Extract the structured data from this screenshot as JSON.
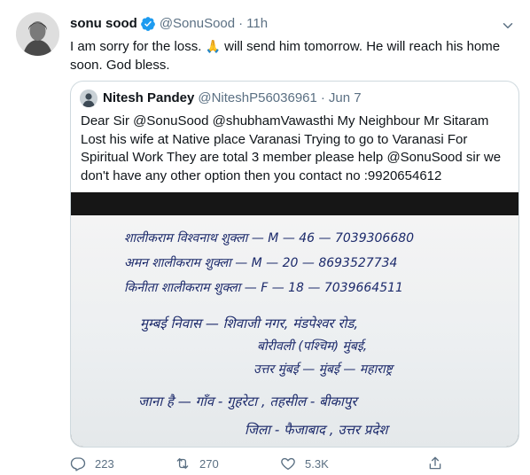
{
  "tweet": {
    "author_name": "sonu sood",
    "author_handle": "@SonuSood",
    "time": "11h",
    "text_before_emoji": "I am sorry for the loss. ",
    "emoji": "🙏",
    "text_after_emoji": " will send him tomorrow. He will reach his home soon. God bless."
  },
  "quote": {
    "author_name": "Nitesh Pandey",
    "author_handle": "@NiteshP56036961",
    "date": "Jun 7",
    "text": "Dear Sir @SonuSood @shubhamVawasthi My Neighbour Mr Sitaram Lost his wife at Native place Varanasi Trying to go to Varanasi For Spiritual Work They are total 3 member please help @SonuSood  sir we don't have any other option then you contact no :9920654612",
    "note_lines": [
      "शालीकराम विश्वनाथ शुक्ला — M — 46 — 7039306680",
      "अमन   शालीकराम शुक्ला — M — 20 — 8693527734",
      "किनीता  शालीकराम शुक्ला — F — 18 — 7039664511",
      "मुम्बई निवास — शिवाजी नगर, मंडपेश्वर रोड,",
      "बोरीवली (पश्चिम) मुंबई,",
      "उत्तर मुंबई — मुंबई — महाराष्ट्र",
      "जाना है — गाँव - गुहरेटा ,  तहसील - बीकापुर",
      "जिला - फैजाबाद , उत्तर प्रदेश"
    ]
  },
  "actions": {
    "replies": "223",
    "retweets": "270",
    "likes": "5.3K"
  },
  "colors": {
    "text": "#0f1419",
    "secondary": "#5b7083",
    "verified": "#1d9bf0",
    "border": "#cfd9de"
  }
}
